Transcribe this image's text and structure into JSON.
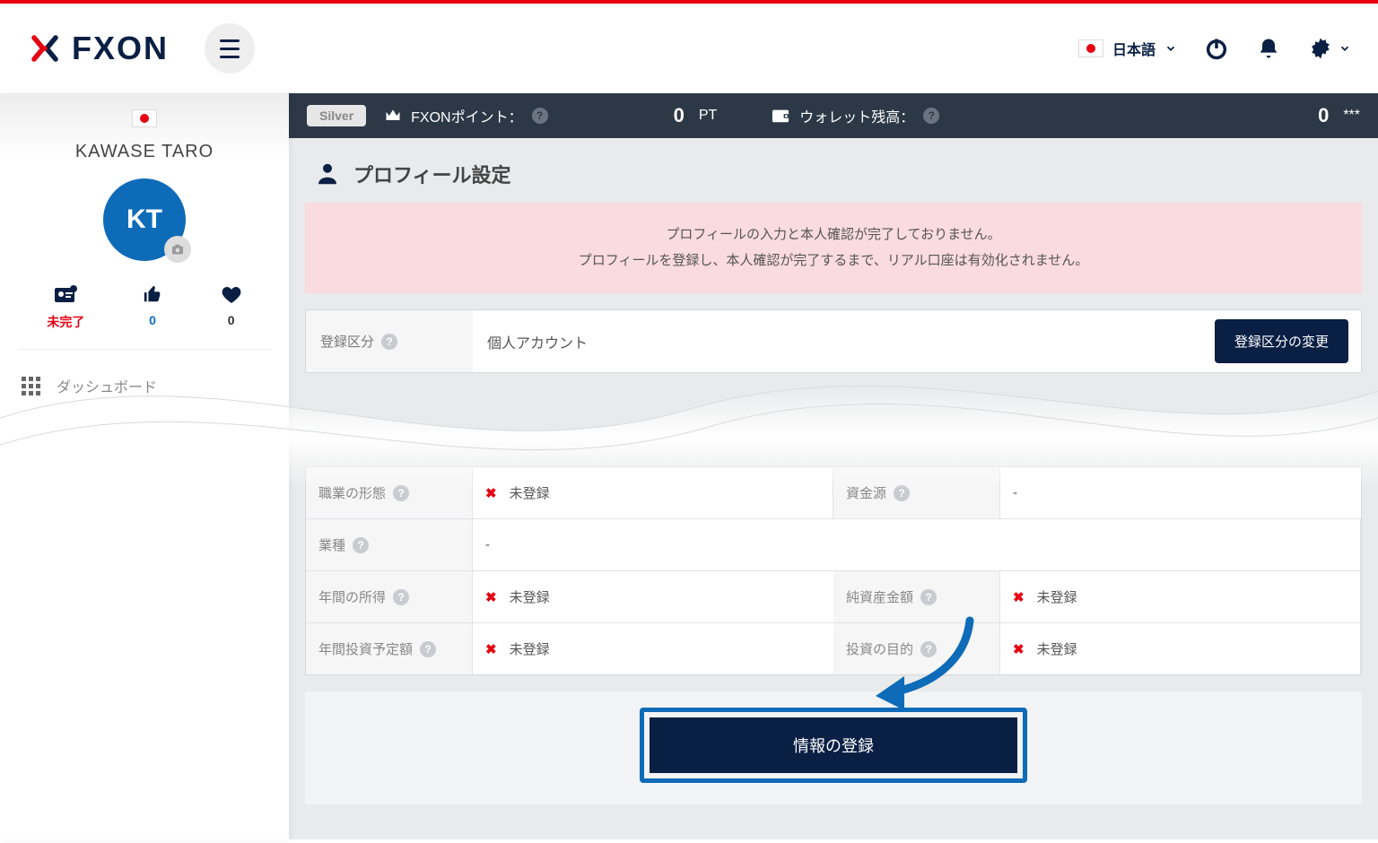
{
  "header": {
    "brand": "FXON",
    "language_label": "日本語"
  },
  "sidebar": {
    "user_name": "KAWASE TARO",
    "avatar_initials": "KT",
    "stats": {
      "status_label": "未完了",
      "likes": "0",
      "favorites": "0"
    },
    "nav_dashboard": "ダッシュボード"
  },
  "infobar": {
    "rank_badge": "Silver",
    "points_label": "FXONポイント：",
    "points_value": "0",
    "points_unit": "PT",
    "wallet_label": "ウォレット残高：",
    "wallet_value": "0",
    "wallet_masked": "***"
  },
  "page": {
    "title": "プロフィール設定",
    "alert_line1": "プロフィールの入力と本人確認が完了しておりません。",
    "alert_line2": "プロフィールを登録し、本人確認が完了するまで、リアル口座は有効化されません。",
    "account_type_label": "登録区分",
    "account_type_value": "個人アカウント",
    "change_button": "登録区分の変更",
    "rows": {
      "employment_form": "職業の形態",
      "funds_source": "資金源",
      "industry": "業種",
      "annual_income": "年間の所得",
      "net_assets": "純資産金額",
      "annual_investment": "年間投資予定額",
      "investment_purpose": "投資の目的"
    },
    "unregistered": "未登録",
    "dash": "-",
    "cta": "情報の登録"
  }
}
